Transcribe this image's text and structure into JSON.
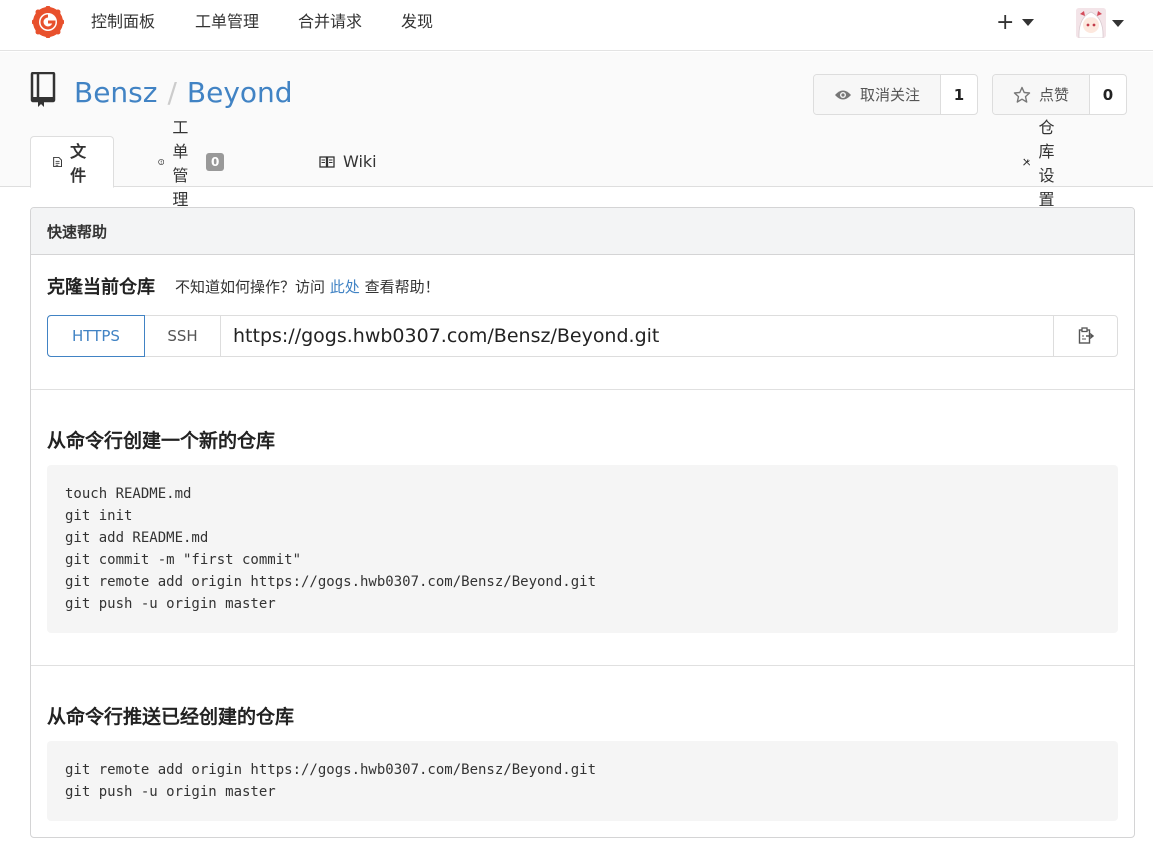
{
  "navbar": {
    "items": [
      "控制面板",
      "工单管理",
      "合并请求",
      "发现"
    ],
    "plus_symbol": "+"
  },
  "repo": {
    "owner": "Bensz",
    "separator": "/",
    "name": "Beyond",
    "watch": {
      "label": "取消关注",
      "count": "1"
    },
    "star": {
      "label": "点赞",
      "count": "0"
    }
  },
  "tabs": {
    "files": "文件",
    "issues": "工单管理",
    "issues_count": "0",
    "wiki": "Wiki",
    "settings": "仓库设置"
  },
  "panel": {
    "header": "快速帮助",
    "clone": {
      "title": "克隆当前仓库",
      "help_prefix": "不知道如何操作？访问",
      "help_link": "此处",
      "help_suffix": "查看帮助！",
      "https_label": "HTTPS",
      "ssh_label": "SSH",
      "url": "https://gogs.hwb0307.com/Bensz/Beyond.git"
    },
    "create_new": {
      "title": "从命令行创建一个新的仓库",
      "code": "touch README.md\ngit init\ngit add README.md\ngit commit -m \"first commit\"\ngit remote add origin https://gogs.hwb0307.com/Bensz/Beyond.git\ngit push -u origin master"
    },
    "push_existing": {
      "title": "从命令行推送已经创建的仓库",
      "code": "git remote add origin https://gogs.hwb0307.com/Bensz/Beyond.git\ngit push -u origin master"
    }
  },
  "colors": {
    "link": "#4183c4",
    "logo": "#e8512d"
  }
}
